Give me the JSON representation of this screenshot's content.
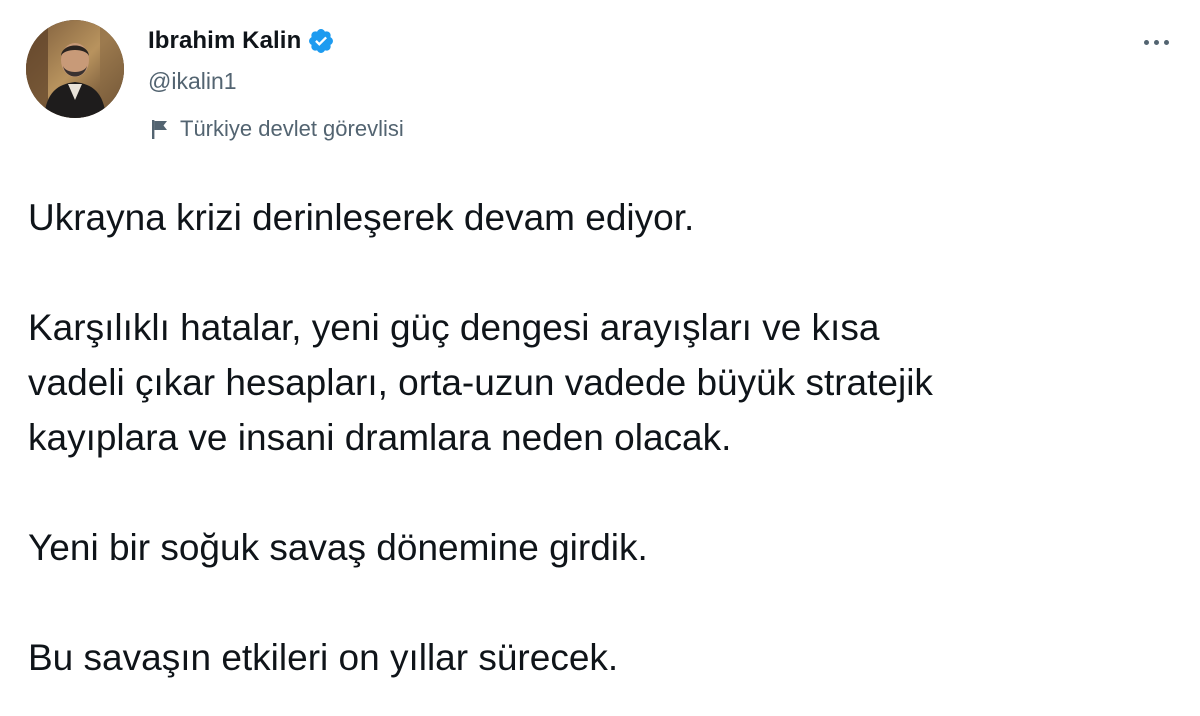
{
  "author": {
    "display_name": "Ibrahim Kalin",
    "handle": "@ikalin1",
    "verified": true,
    "avatar_icon": "profile-photo",
    "account_label": "Türkiye devlet görevlisi",
    "account_label_icon": "flag-icon"
  },
  "actions": {
    "more_icon": "more-horizontal-icon"
  },
  "tweet": {
    "paragraphs": [
      "Ukrayna krizi derinleşerek devam ediyor.",
      "Karşılıklı hatalar, yeni güç dengesi arayışları ve kısa\nvadeli çıkar hesapları, orta-uzun vadede büyük stratejik\nkayıplara ve insani dramlara neden olacak.",
      "Yeni bir soğuk savaş dönemine girdik.",
      "Bu savaşın etkileri on yıllar sürecek."
    ]
  },
  "colors": {
    "text_primary": "#0f1419",
    "text_secondary": "#536471",
    "verified_blue": "#1d9bf0"
  }
}
